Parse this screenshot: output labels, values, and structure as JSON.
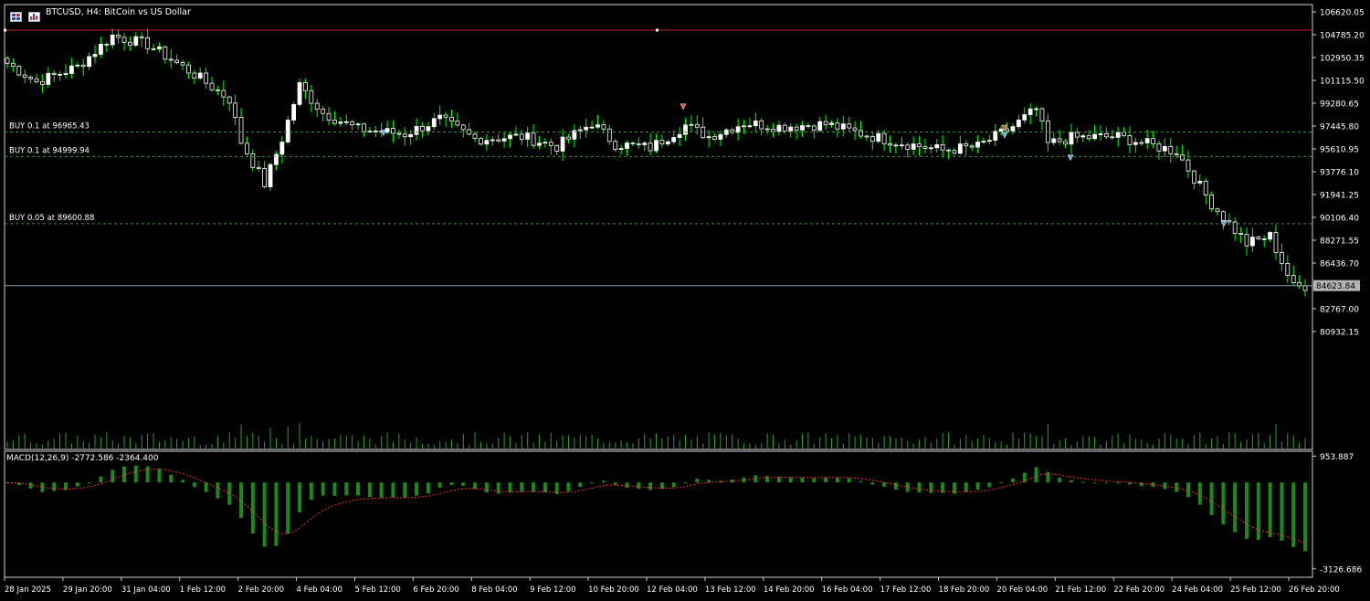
{
  "header": {
    "title": "BTCUSD, H4:  BitCoin vs US Dollar",
    "grid_icon": "grid-icon",
    "chart_type_icon": "chart-type-icon"
  },
  "colors": {
    "background": "#000000",
    "foreground": "#ffffff",
    "bull": "#ffffff",
    "bear": "#ffffff",
    "wick": "#00ff00",
    "order_line": "#2ea02e",
    "stop_line": "#d11f1f",
    "price_line": "#8aa0b4",
    "volume": "#2f9e2f",
    "macd_hist": "#1b8a1b",
    "macd_signal": "#ff3333"
  },
  "chart_data": [
    {
      "type": "candlestick",
      "price_axis": {
        "ticks": [
          "106620.05",
          "104785.20",
          "102950.35",
          "101115.50",
          "99280.65",
          "97445.80",
          "95610.95",
          "93776.10",
          "91941.25",
          "90106.40",
          "88271.55",
          "86436.70",
          "82767.00",
          "80932.15"
        ],
        "range": [
          80000,
          107000
        ]
      },
      "time_axis": {
        "labels": [
          "28 Jan 2025",
          "29 Jan 20:00",
          "31 Jan 04:00",
          "1 Feb 12:00",
          "2 Feb 20:00",
          "4 Feb 04:00",
          "5 Feb 12:00",
          "6 Feb 20:00",
          "8 Feb 04:00",
          "9 Feb 12:00",
          "10 Feb 20:00",
          "12 Feb 04:00",
          "13 Feb 12:00",
          "14 Feb 20:00",
          "16 Feb 04:00",
          "17 Feb 12:00",
          "18 Feb 20:00",
          "20 Feb 04:00",
          "21 Feb 12:00",
          "22 Feb 20:00",
          "24 Feb 04:00",
          "25 Feb 12:00",
          "26 Feb 20:00"
        ]
      },
      "current_price": "84623.84",
      "stop_level": 105150,
      "orders": [
        {
          "label": "BUY 0.1 at 96965.43",
          "price": 96965.43
        },
        {
          "label": "BUY 0.1 at 94999.94",
          "price": 94999.94
        },
        {
          "label": "BUY 0.05 at 89600.88",
          "price": 89600.88
        }
      ],
      "anchors": [
        [
          0,
          102500
        ],
        [
          5,
          101000
        ],
        [
          12,
          102200
        ],
        [
          18,
          104700
        ],
        [
          24,
          104000
        ],
        [
          32,
          101600
        ],
        [
          38,
          99600
        ],
        [
          40,
          96200
        ],
        [
          44,
          92800
        ],
        [
          47,
          96400
        ],
        [
          50,
          100700
        ],
        [
          54,
          98500
        ],
        [
          60,
          97200
        ],
        [
          68,
          96800
        ],
        [
          74,
          98000
        ],
        [
          80,
          96400
        ],
        [
          88,
          96600
        ],
        [
          94,
          95800
        ],
        [
          100,
          97700
        ],
        [
          104,
          96000
        ],
        [
          110,
          95700
        ],
        [
          116,
          97500
        ],
        [
          120,
          96600
        ],
        [
          126,
          97700
        ],
        [
          132,
          97400
        ],
        [
          140,
          97600
        ],
        [
          148,
          96600
        ],
        [
          154,
          96000
        ],
        [
          160,
          95500
        ],
        [
          166,
          95800
        ],
        [
          172,
          97400
        ],
        [
          176,
          98800
        ],
        [
          178,
          96000
        ],
        [
          182,
          96500
        ],
        [
          190,
          96600
        ],
        [
          200,
          95400
        ],
        [
          206,
          91200
        ],
        [
          212,
          88000
        ],
        [
          216,
          88600
        ],
        [
          220,
          84500
        ],
        [
          222,
          84600
        ]
      ]
    },
    {
      "type": "macd",
      "title": "MACD(12,26,9) -2772.586 -2364.400",
      "ticks": [
        "953.887",
        "-3126.686"
      ],
      "range": [
        -3300,
        1000
      ]
    }
  ]
}
